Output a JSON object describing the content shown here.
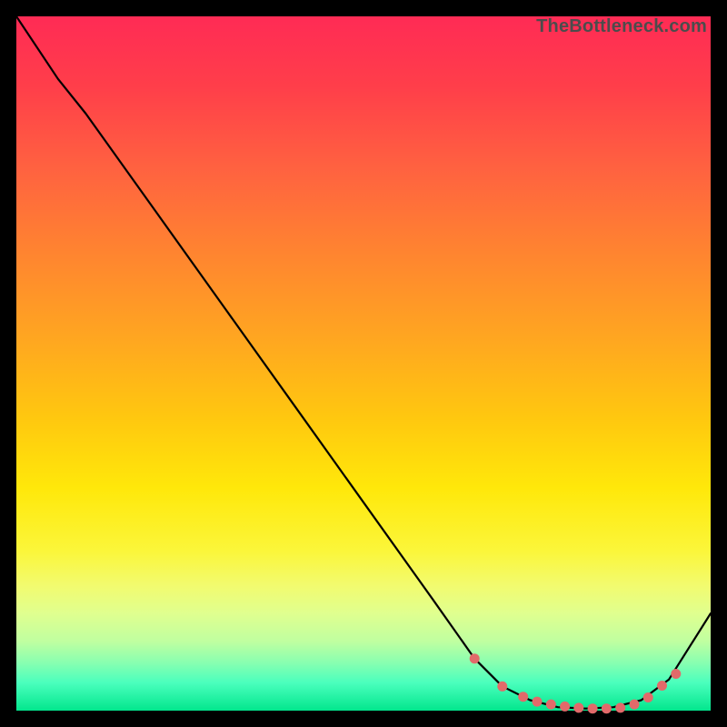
{
  "watermark": "TheBottleneck.com",
  "colors": {
    "curve": "#000000",
    "marker": "#e26a6a",
    "background_top": "#ff2b55",
    "background_bottom": "#02e68d",
    "page_bg": "#000000"
  },
  "chart_data": {
    "type": "line",
    "title": "",
    "xlabel": "",
    "ylabel": "",
    "xlim": [
      0,
      100
    ],
    "ylim": [
      0,
      100
    ],
    "grid": false,
    "series": [
      {
        "name": "bottleneck-curve",
        "x": [
          0,
          6,
          10,
          20,
          30,
          40,
          50,
          60,
          66,
          70,
          74,
          78,
          82,
          86,
          90,
          94,
          100
        ],
        "values": [
          100,
          91,
          86,
          72,
          58,
          44,
          30,
          16,
          7.5,
          3.5,
          1.5,
          0.5,
          0.3,
          0.5,
          1.5,
          4.5,
          14
        ]
      }
    ],
    "markers": {
      "name": "highlight-dots",
      "x": [
        66,
        70,
        73,
        75,
        77,
        79,
        81,
        83,
        85,
        87,
        89,
        91,
        93,
        95
      ],
      "values": [
        7.5,
        3.5,
        2.0,
        1.3,
        0.9,
        0.6,
        0.4,
        0.3,
        0.3,
        0.4,
        0.9,
        1.9,
        3.6,
        5.3
      ]
    }
  }
}
